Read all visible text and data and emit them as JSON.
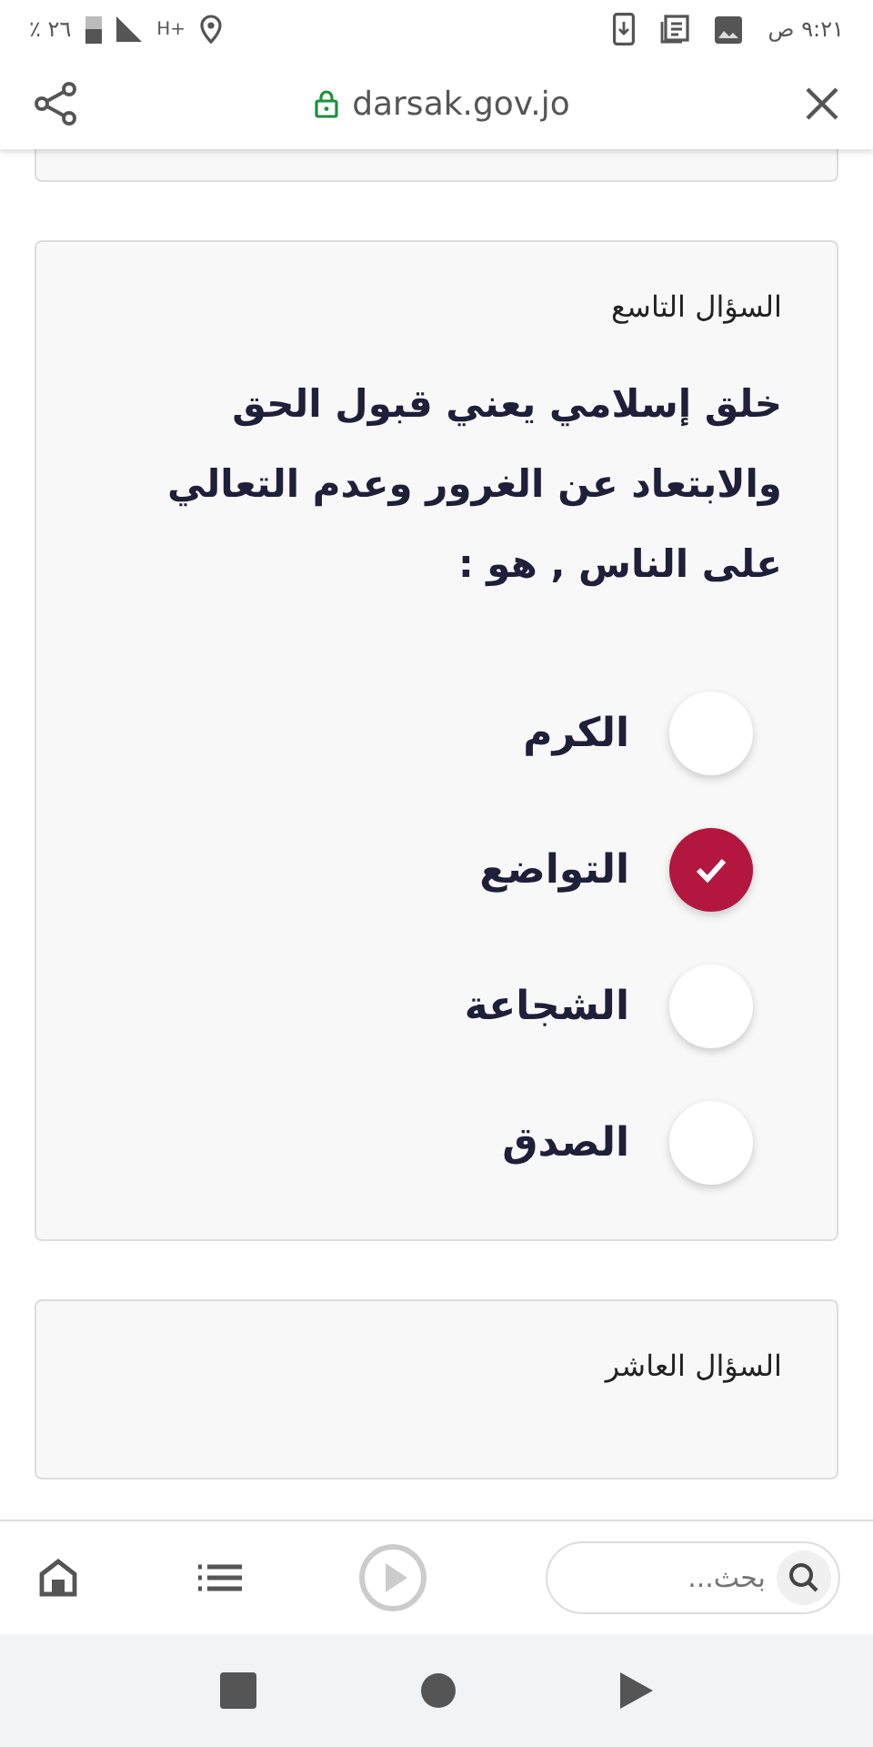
{
  "status_bar": {
    "time": "٩:٢١ ص",
    "network": "H+",
    "battery": "٢٦ ٪"
  },
  "browser_bar": {
    "url": "darsak.gov.jo"
  },
  "questions": [
    {
      "title": "السؤال التاسع",
      "text": "خلق إسلامي يعني قبول الحق والابتعاد عن الغرور وعدم التعالي على الناس , هو :",
      "options": [
        {
          "label": "الكرم",
          "selected": false
        },
        {
          "label": "التواضع",
          "selected": true
        },
        {
          "label": "الشجاعة",
          "selected": false
        },
        {
          "label": "الصدق",
          "selected": false
        }
      ]
    },
    {
      "title": "السؤال العاشر"
    }
  ],
  "toolbar": {
    "search": {
      "placeholder": "بحث..."
    }
  }
}
